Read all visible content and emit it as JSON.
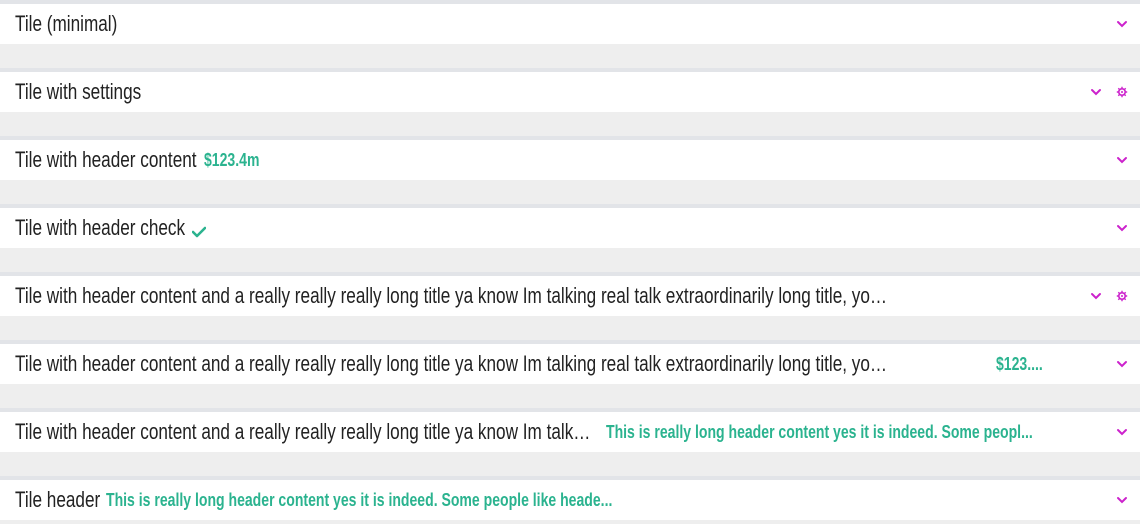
{
  "accent_color": "#cc22cc",
  "header_content_color": "#2bb38f",
  "tiles": [
    {
      "title": "Tile (minimal)",
      "icons": [
        "chevron-down-icon"
      ]
    },
    {
      "title": "Tile with settings",
      "icons": [
        "chevron-down-icon",
        "gear-icon"
      ]
    },
    {
      "title": "Tile with header content",
      "header_content": "$123.4m",
      "icons": [
        "chevron-down-icon"
      ]
    },
    {
      "title": "Tile with header check",
      "icons": [
        "check-icon",
        "chevron-down-icon"
      ]
    },
    {
      "title": "Tile with header content and a really really really long title ya know Im talking real talk extraordinarily long title, you wouldnt let ya bo...",
      "icons": [
        "chevron-down-icon",
        "gear-icon"
      ]
    },
    {
      "title": "Tile with header content and a really really really long title ya know Im talking real talk extraordinarily long title, you wouldnt let ...",
      "header_content": "$123....",
      "icons": [
        "chevron-down-icon"
      ]
    },
    {
      "title": "Tile with header content and a really really really long title ya know Im talkin...",
      "header_content": "This is really long header content yes it is indeed. Some peopl...",
      "icons": [
        "chevron-down-icon"
      ]
    },
    {
      "title": "Tile header",
      "header_content": "This is really long header content yes it is indeed. Some people like heade...",
      "icons": [
        "chevron-down-icon"
      ]
    }
  ]
}
